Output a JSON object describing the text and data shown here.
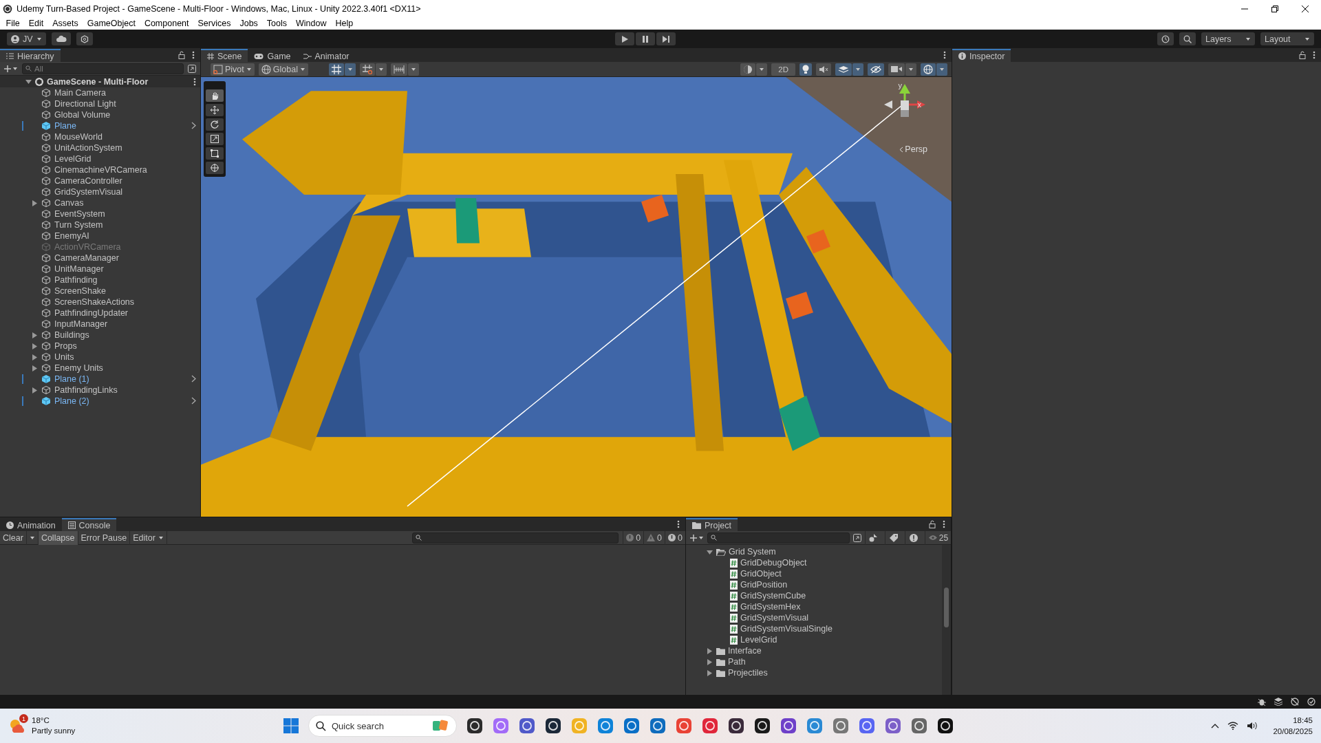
{
  "window": {
    "title": "Udemy Turn-Based Project - GameScene - Multi-Floor - Windows, Mac, Linux - Unity 2022.3.40f1 <DX11>"
  },
  "menu": [
    "File",
    "Edit",
    "Assets",
    "GameObject",
    "Component",
    "Services",
    "Jobs",
    "Tools",
    "Window",
    "Help"
  ],
  "toolbar": {
    "account": "JV",
    "layers": "Layers",
    "layout": "Layout"
  },
  "hierarchy": {
    "title": "Hierarchy",
    "search_placeholder": "All",
    "scene": "GameScene - Multi-Floor",
    "items": [
      {
        "name": "Main Camera",
        "kind": "object",
        "has_children": false,
        "active": true
      },
      {
        "name": "Directional Light",
        "kind": "object",
        "has_children": false,
        "active": true
      },
      {
        "name": "Global Volume",
        "kind": "object",
        "has_children": false,
        "active": true
      },
      {
        "name": "Plane",
        "kind": "prefab",
        "has_children": false,
        "active": true
      },
      {
        "name": "MouseWorld",
        "kind": "object",
        "has_children": false,
        "active": true
      },
      {
        "name": "UnitActionSystem",
        "kind": "object",
        "has_children": false,
        "active": true
      },
      {
        "name": "LevelGrid",
        "kind": "object",
        "has_children": false,
        "active": true
      },
      {
        "name": "CinemachineVRCamera",
        "kind": "object",
        "has_children": false,
        "active": true
      },
      {
        "name": "CameraController",
        "kind": "object",
        "has_children": false,
        "active": true
      },
      {
        "name": "GridSystemVisual",
        "kind": "object",
        "has_children": false,
        "active": true
      },
      {
        "name": "Canvas",
        "kind": "object",
        "has_children": true,
        "active": true
      },
      {
        "name": "EventSystem",
        "kind": "object",
        "has_children": false,
        "active": true
      },
      {
        "name": "Turn System",
        "kind": "object",
        "has_children": false,
        "active": true
      },
      {
        "name": "EnemyAI",
        "kind": "object",
        "has_children": false,
        "active": true
      },
      {
        "name": "ActionVRCamera",
        "kind": "object",
        "has_children": false,
        "active": false
      },
      {
        "name": "CameraManager",
        "kind": "object",
        "has_children": false,
        "active": true
      },
      {
        "name": "UnitManager",
        "kind": "object",
        "has_children": false,
        "active": true
      },
      {
        "name": "Pathfinding",
        "kind": "object",
        "has_children": false,
        "active": true
      },
      {
        "name": "ScreenShake",
        "kind": "object",
        "has_children": false,
        "active": true
      },
      {
        "name": "ScreenShakeActions",
        "kind": "object",
        "has_children": false,
        "active": true
      },
      {
        "name": "PathfindingUpdater",
        "kind": "object",
        "has_children": false,
        "active": true
      },
      {
        "name": "InputManager",
        "kind": "object",
        "has_children": false,
        "active": true
      },
      {
        "name": "Buildings",
        "kind": "object",
        "has_children": true,
        "active": true
      },
      {
        "name": "Props",
        "kind": "object",
        "has_children": true,
        "active": true
      },
      {
        "name": "Units",
        "kind": "object",
        "has_children": true,
        "active": true
      },
      {
        "name": "Enemy Units",
        "kind": "object",
        "has_children": true,
        "active": true
      },
      {
        "name": "Plane (1)",
        "kind": "prefab",
        "has_children": false,
        "active": true
      },
      {
        "name": "PathfindingLinks",
        "kind": "object",
        "has_children": true,
        "active": true
      },
      {
        "name": "Plane (2)",
        "kind": "prefab",
        "has_children": false,
        "active": true
      }
    ]
  },
  "scene_view": {
    "tabs": [
      {
        "label": "Scene",
        "selected": true
      },
      {
        "label": "Game",
        "selected": false
      },
      {
        "label": "Animator",
        "selected": false
      }
    ],
    "pivot": "Pivot",
    "space": "Global",
    "snapping": [
      {
        "kind": "grid",
        "on": true
      },
      {
        "kind": "snap",
        "on": false
      },
      {
        "kind": "increment",
        "on": false
      }
    ],
    "toggles": [
      {
        "kind": "shading",
        "on": false
      },
      {
        "kind": "mode2d",
        "label": "2D",
        "on": false
      },
      {
        "kind": "lighting",
        "on": true
      },
      {
        "kind": "audio",
        "on": false
      },
      {
        "kind": "effects",
        "on": true
      },
      {
        "kind": "hidden",
        "on": true
      },
      {
        "kind": "camera",
        "on": false
      },
      {
        "kind": "gizmos",
        "on": true
      }
    ],
    "axes": [
      "y",
      "x"
    ],
    "projection": "Persp"
  },
  "inspector": {
    "title": "Inspector"
  },
  "console": {
    "tabs": [
      {
        "label": "Animation",
        "selected": false
      },
      {
        "label": "Console",
        "selected": true
      }
    ],
    "buttons": [
      {
        "label": "Clear",
        "kind": "split",
        "on": false
      },
      {
        "label": "Collapse",
        "kind": "toggle",
        "on": true
      },
      {
        "label": "Error Pause",
        "kind": "toggle",
        "on": false
      },
      {
        "label": "Editor",
        "kind": "dropdown",
        "on": false
      }
    ],
    "counts": [
      {
        "kind": "info",
        "count": "0"
      },
      {
        "kind": "warning",
        "count": "0"
      },
      {
        "kind": "error",
        "count": "0"
      }
    ]
  },
  "project": {
    "title": "Project",
    "visible_count": "25",
    "tree": [
      {
        "name": "Grid System",
        "kind": "folder",
        "expanded": true,
        "children": [
          {
            "name": "GridDebugObject",
            "kind": "script"
          },
          {
            "name": "GridObject",
            "kind": "script"
          },
          {
            "name": "GridPosition",
            "kind": "script"
          },
          {
            "name": "GridSystemCube",
            "kind": "script"
          },
          {
            "name": "GridSystemHex",
            "kind": "script"
          },
          {
            "name": "GridSystemVisual",
            "kind": "script"
          },
          {
            "name": "GridSystemVisualSingle",
            "kind": "script"
          },
          {
            "name": "LevelGrid",
            "kind": "script"
          }
        ]
      },
      {
        "name": "Interface",
        "kind": "folder",
        "expanded": false
      },
      {
        "name": "Path",
        "kind": "folder",
        "expanded": false
      },
      {
        "name": "Projectiles",
        "kind": "folder",
        "expanded": false
      }
    ]
  },
  "taskbar": {
    "weather": {
      "badge": "1",
      "temperature": "18°C",
      "condition": "Partly sunny"
    },
    "search_placeholder": "Quick search",
    "time": "18:45",
    "date": "20/08/2025"
  }
}
